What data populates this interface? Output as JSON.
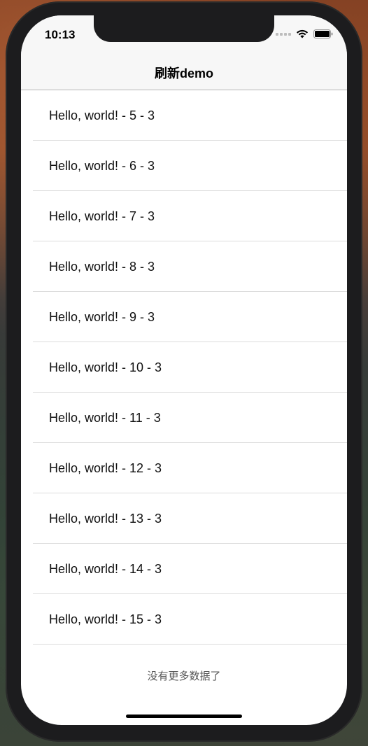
{
  "status_bar": {
    "time": "10:13"
  },
  "nav": {
    "title": "刷新demo"
  },
  "list": {
    "items": [
      {
        "label": "Hello, world! - 5 - 3"
      },
      {
        "label": "Hello, world! - 6 - 3"
      },
      {
        "label": "Hello, world! - 7 - 3"
      },
      {
        "label": "Hello, world! - 8 - 3"
      },
      {
        "label": "Hello, world! - 9 - 3"
      },
      {
        "label": "Hello, world! - 10 - 3"
      },
      {
        "label": "Hello, world! - 11 - 3"
      },
      {
        "label": "Hello, world! - 12 - 3"
      },
      {
        "label": "Hello, world! - 13 - 3"
      },
      {
        "label": "Hello, world! - 14 - 3"
      },
      {
        "label": "Hello, world! - 15 - 3"
      }
    ]
  },
  "footer": {
    "text": "没有更多数据了"
  },
  "icons": {
    "signal": "cellular-signal-icon",
    "wifi": "wifi-icon",
    "battery": "battery-icon"
  }
}
